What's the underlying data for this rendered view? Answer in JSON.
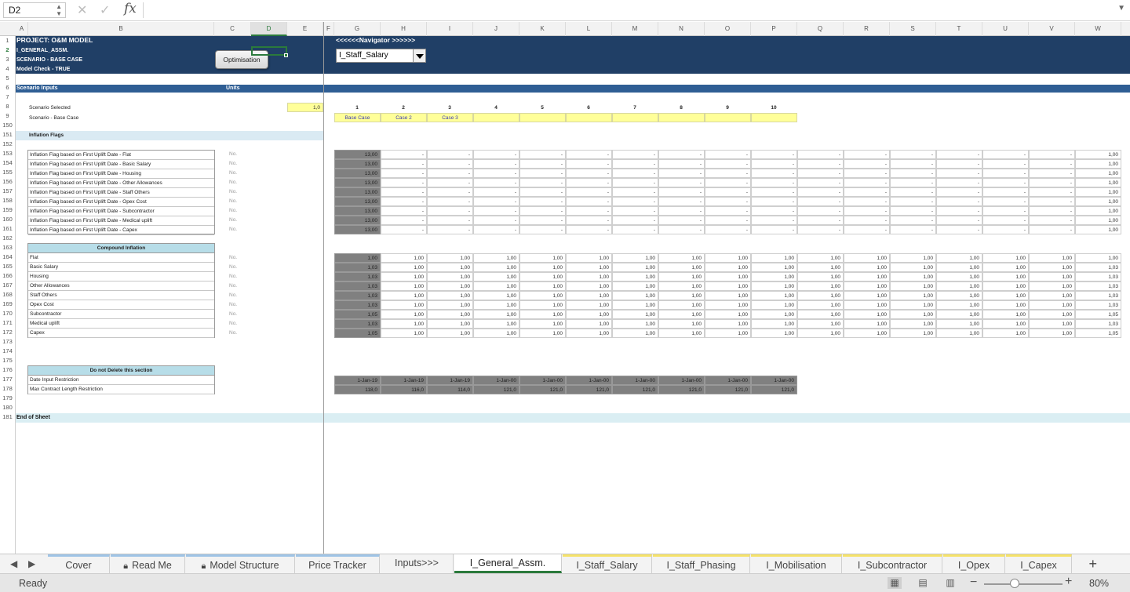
{
  "formula_bar": {
    "name_box": "D2",
    "fx_label": "fx",
    "formula": ""
  },
  "columns": [
    "A",
    "B",
    "C",
    "D",
    "E",
    "F",
    "G",
    "H",
    "I",
    "J",
    "K",
    "L",
    "M",
    "N",
    "O",
    "P",
    "Q",
    "R",
    "S",
    "T",
    "U",
    "V",
    "W"
  ],
  "header": {
    "project": "PROJECT: O&M MODEL",
    "sheet": "I_GENERAL_ASSM.",
    "scenario": "SCENARIO - BASE CASE",
    "model_check": "Model Check - TRUE",
    "navigator_label": "<<<<<<Navigator >>>>>>",
    "navigator_value": "I_Staff_Salary",
    "optimisation_button": "Optimisation"
  },
  "scenario_inputs": {
    "title": "Scenario Inputs",
    "units": "Units",
    "selected_label": "Scenario Selected",
    "selected_value": "1,0",
    "base_label": "Scenario - Base Case",
    "numbers": [
      "1",
      "2",
      "3",
      "4",
      "5",
      "6",
      "7",
      "8",
      "9",
      "10"
    ],
    "cases": [
      "Base Case",
      "Case 2",
      "Case 3",
      "",
      "",
      "",
      "",
      "",
      "",
      ""
    ]
  },
  "inflation_flags": {
    "title": "Inflation Flags",
    "rows": [
      {
        "label": "Inflation Flag based on First Uplift Date - Flat",
        "unit": "No.",
        "first": "13,00",
        "last": "1,00"
      },
      {
        "label": "Inflation Flag based on First Uplift Date - Basic Salary",
        "unit": "No.",
        "first": "13,00",
        "last": "1,00"
      },
      {
        "label": "Inflation Flag based on First Uplift Date - Housing",
        "unit": "No.",
        "first": "13,00",
        "last": "1,00"
      },
      {
        "label": "Inflation Flag based on First Uplift Date - Other Allowances",
        "unit": "No.",
        "first": "13,00",
        "last": "1,00"
      },
      {
        "label": "Inflation Flag based on First Uplift Date - Staff Others",
        "unit": "No.",
        "first": "13,00",
        "last": "1,00"
      },
      {
        "label": "Inflation Flag based on First Uplift Date - Opex Cost",
        "unit": "No.",
        "first": "13,00",
        "last": "1,00"
      },
      {
        "label": "Inflation Flag based on First Uplift Date - Subcontractor",
        "unit": "No.",
        "first": "13,00",
        "last": "1,00"
      },
      {
        "label": "Inflation Flag based on First Uplift Date - Medical uplift",
        "unit": "No.",
        "first": "13,00",
        "last": "1,00"
      },
      {
        "label": "Inflation Flag based on First Uplift Date - Capex",
        "unit": "No.",
        "first": "13,00",
        "last": "1,00"
      }
    ],
    "dash": "-"
  },
  "compound_inflation": {
    "title": "Compound Inflation",
    "rows": [
      {
        "label": "Flat",
        "unit": "No.",
        "first": "1,00",
        "mid": "1,00",
        "last": "1,00"
      },
      {
        "label": "Basic Salary",
        "unit": "No.",
        "first": "1,03",
        "mid": "1,00",
        "last": "1,03"
      },
      {
        "label": "Housing",
        "unit": "No.",
        "first": "1,03",
        "mid": "1,00",
        "last": "1,03"
      },
      {
        "label": "Other Allowances",
        "unit": "No.",
        "first": "1,03",
        "mid": "1,00",
        "last": "1,03"
      },
      {
        "label": "Staff Others",
        "unit": "No.",
        "first": "1,03",
        "mid": "1,00",
        "last": "1,03"
      },
      {
        "label": "Opex Cost",
        "unit": "No.",
        "first": "1,03",
        "mid": "1,00",
        "last": "1,03"
      },
      {
        "label": "Subcontractor",
        "unit": "No.",
        "first": "1,05",
        "mid": "1,00",
        "last": "1,05"
      },
      {
        "label": "Medical uplift",
        "unit": "No.",
        "first": "1,03",
        "mid": "1,00",
        "last": "1,03"
      },
      {
        "label": "Capex",
        "unit": "No.",
        "first": "1,05",
        "mid": "1,00",
        "last": "1,05"
      }
    ]
  },
  "do_not_delete": {
    "title": "Do not Delete this section",
    "rows": [
      "Date Input Restriction",
      "Max Contract Length Restriction"
    ],
    "dates": [
      "1-Jan-19",
      "1-Jan-19",
      "1-Jan-19",
      "1-Jan-00",
      "1-Jan-00",
      "1-Jan-00",
      "1-Jan-00",
      "1-Jan-00",
      "1-Jan-00",
      "1-Jan-00"
    ],
    "lengths": [
      "118,0",
      "116,0",
      "114,0",
      "121,0",
      "121,0",
      "121,0",
      "121,0",
      "121,0",
      "121,0",
      "121,0"
    ]
  },
  "end_of_sheet": "End of Sheet",
  "rows_numbers": [
    "1",
    "2",
    "3",
    "4",
    "5",
    "6",
    "7",
    "8",
    "9",
    "150",
    "151",
    "152",
    "153",
    "154",
    "155",
    "156",
    "157",
    "158",
    "159",
    "160",
    "161",
    "162",
    "163",
    "164",
    "165",
    "166",
    "167",
    "168",
    "169",
    "170",
    "171",
    "172",
    "173",
    "174",
    "175",
    "176",
    "177",
    "178",
    "179",
    "180",
    "181"
  ],
  "sheet_tabs": [
    {
      "label": "Cover",
      "lock": false,
      "color": "blue"
    },
    {
      "label": "Read Me",
      "lock": true,
      "color": "blue"
    },
    {
      "label": "Model Structure",
      "lock": true,
      "color": "blue"
    },
    {
      "label": "Price Tracker",
      "lock": false,
      "color": "blue"
    },
    {
      "label": "Inputs>>>",
      "lock": false,
      "color": "none"
    },
    {
      "label": "I_General_Assm.",
      "lock": false,
      "color": "active"
    },
    {
      "label": "I_Staff_Salary",
      "lock": false,
      "color": "yellow"
    },
    {
      "label": "I_Staff_Phasing",
      "lock": false,
      "color": "yellow"
    },
    {
      "label": "I_Mobilisation",
      "lock": false,
      "color": "yellow"
    },
    {
      "label": "I_Subcontractor",
      "lock": false,
      "color": "yellow"
    },
    {
      "label": "I_Opex",
      "lock": false,
      "color": "yellow"
    },
    {
      "label": "I_Capex",
      "lock": false,
      "color": "yellow"
    }
  ],
  "status": {
    "text": "Ready",
    "zoom": "80%",
    "zoom_level": 0.4
  },
  "icons": {
    "cancel": "close-icon",
    "confirm": "check-icon",
    "add_sheet": "plus-icon",
    "lock": "lock-icon"
  }
}
